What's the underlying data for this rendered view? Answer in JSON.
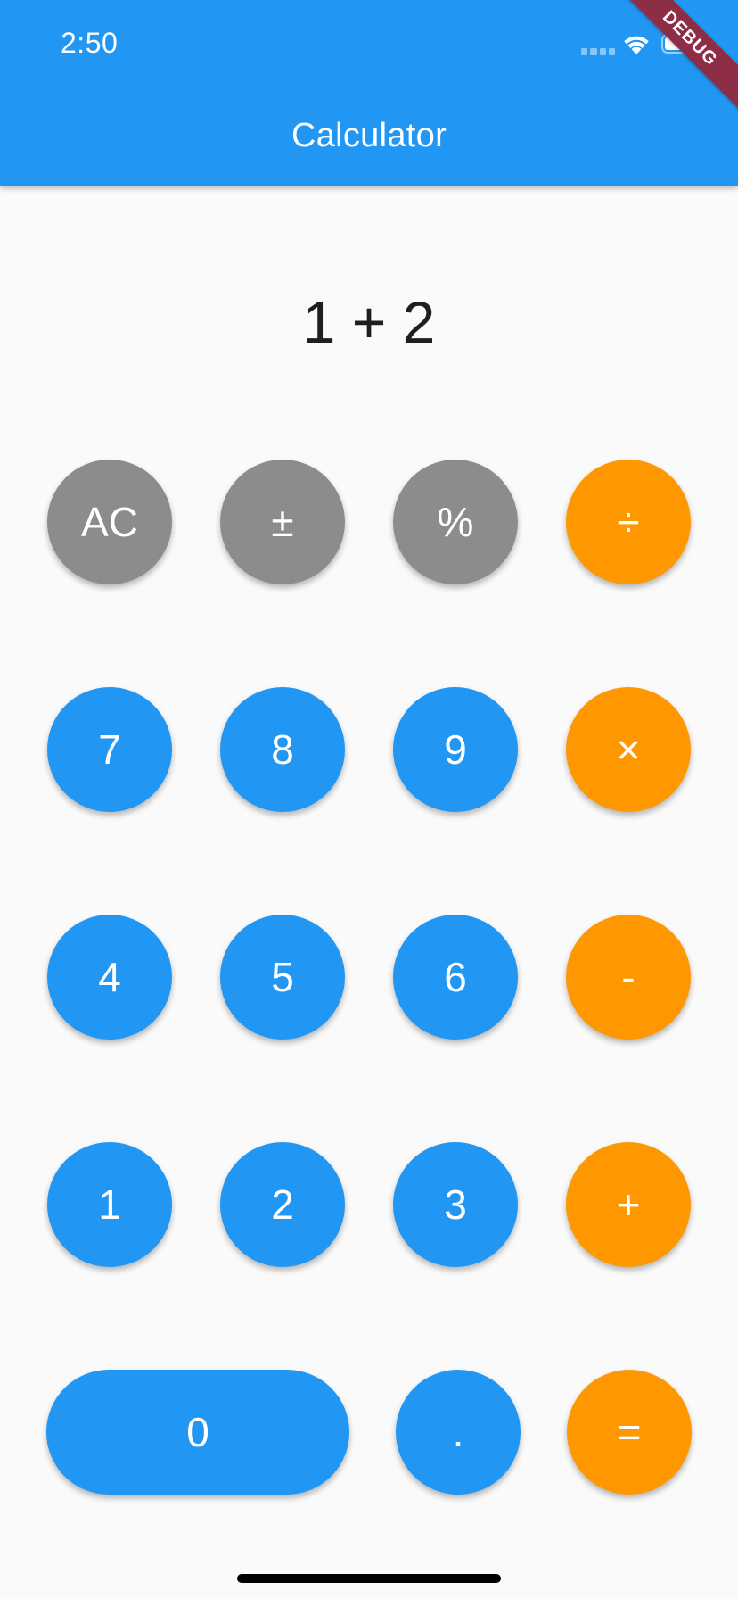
{
  "status_bar": {
    "time": "2:50"
  },
  "app_bar": {
    "title": "Calculator",
    "color": "#2196F3"
  },
  "debug_banner": {
    "label": "DEBUG",
    "color": "#8E2E46"
  },
  "display": {
    "expression": "1 + 2"
  },
  "keypad": {
    "colors": {
      "function": "#8C8C8C",
      "digit": "#2196F3",
      "operator": "#FF9800"
    },
    "rows": [
      [
        {
          "label": "AC",
          "kind": "function"
        },
        {
          "label": "±",
          "kind": "function"
        },
        {
          "label": "%",
          "kind": "function"
        },
        {
          "label": "÷",
          "kind": "operator"
        }
      ],
      [
        {
          "label": "7",
          "kind": "digit"
        },
        {
          "label": "8",
          "kind": "digit"
        },
        {
          "label": "9",
          "kind": "digit"
        },
        {
          "label": "×",
          "kind": "operator"
        }
      ],
      [
        {
          "label": "4",
          "kind": "digit"
        },
        {
          "label": "5",
          "kind": "digit"
        },
        {
          "label": "6",
          "kind": "digit"
        },
        {
          "label": "-",
          "kind": "operator"
        }
      ],
      [
        {
          "label": "1",
          "kind": "digit"
        },
        {
          "label": "2",
          "kind": "digit"
        },
        {
          "label": "3",
          "kind": "digit"
        },
        {
          "label": "+",
          "kind": "operator"
        }
      ],
      [
        {
          "label": "0",
          "kind": "digit"
        },
        {
          "label": ".",
          "kind": "digit"
        },
        {
          "label": "=",
          "kind": "operator"
        }
      ]
    ]
  }
}
